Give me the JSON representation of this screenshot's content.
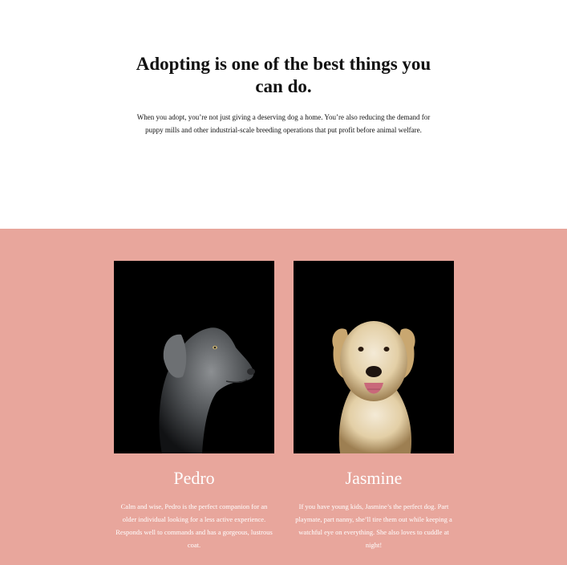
{
  "hero": {
    "title": "Adopting is one of the best things you can do.",
    "body": "When you adopt, you’re not just giving a deserving dog a home. You’re also reducing the demand for puppy mills and other industrial-scale breeding operations that put profit before animal welfare."
  },
  "colors": {
    "band_background": "#e8a69c",
    "text_dark": "#111111",
    "text_light": "#ffffff",
    "photo_background": "#000000"
  },
  "dogs": [
    {
      "name": "Pedro",
      "description": "Calm and wise, Pedro is the perfect companion for an older individual looking for a less active experience. Responds well to commands and has a gorgeous, lustrous coat."
    },
    {
      "name": "Jasmine",
      "description": "If you have young kids, Jasmine’s the perfect dog. Part playmate, part nanny, she’ll tire them out while keeping a watchful eye on everything. She also loves to cuddle at night!"
    }
  ]
}
